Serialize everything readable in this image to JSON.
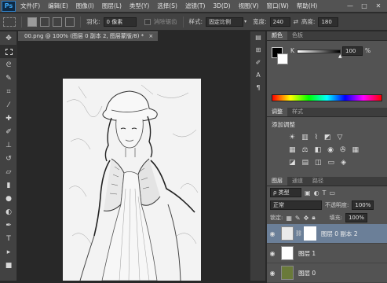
{
  "app": {
    "logo": "Ps"
  },
  "menu": [
    "文件(F)",
    "编辑(E)",
    "图像(I)",
    "图层(L)",
    "类型(Y)",
    "选择(S)",
    "滤镜(T)",
    "3D(D)",
    "视图(V)",
    "窗口(W)",
    "帮助(H)"
  ],
  "window_controls": [
    "—",
    "□",
    "✕"
  ],
  "options": {
    "feather_label": "羽化:",
    "feather_value": "0 像素",
    "antialias_label": "消除锯齿",
    "style_label": "样式:",
    "style_value": "固定比例",
    "width_label": "宽度:",
    "width_value": "240",
    "height_label": "高度:",
    "height_value": "180"
  },
  "document": {
    "tab_title": "00.png @ 100% (图层 0 副本 2, 图层蒙版/8) *",
    "tab_close": "×"
  },
  "color_panel": {
    "tabs": [
      "颜色",
      "色板"
    ],
    "channel_label": "K",
    "value": "100",
    "unit": "%",
    "level": 1.0
  },
  "adjustments_panel": {
    "tabs": [
      "调整",
      "样式"
    ],
    "title": "添加调整"
  },
  "layers_panel": {
    "tabs": [
      "图层",
      "通道",
      "路径"
    ],
    "filter_value": "ρ 类型",
    "blend_mode": "正常",
    "opacity_label": "不透明度:",
    "opacity_value": "100%",
    "lock_label": "锁定:",
    "fill_label": "填充:",
    "fill_value": "100%",
    "layers": [
      {
        "name": "图层 0 副本 2",
        "selected": true
      },
      {
        "name": "图层 1",
        "selected": false
      },
      {
        "name": "图层 0",
        "selected": false
      }
    ]
  },
  "icons": {
    "eye": "eye-icon",
    "mask": "layer-mask-icon",
    "link": "chain-link-icon"
  }
}
